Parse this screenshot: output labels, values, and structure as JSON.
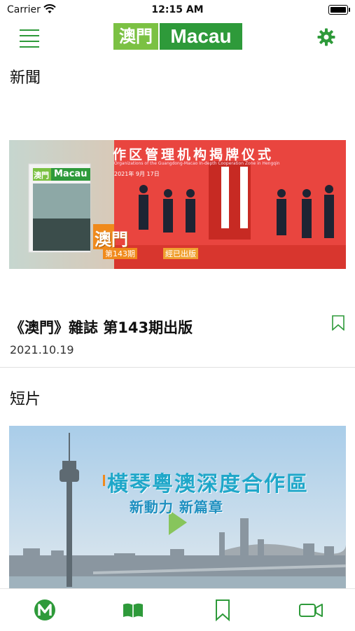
{
  "status": {
    "carrier": "Carrier",
    "time": "12:15 AM"
  },
  "header": {
    "logo_cn": "澳門",
    "logo_en": "Macau"
  },
  "news": {
    "section_label": "新聞",
    "article_title": "《澳門》雜誌 第143期出版",
    "article_date": "2021.10.19",
    "banner_heading": "作区管理机构揭牌仪式",
    "banner_sub": "Organizations of the Guangdong-Macao In-depth Cooperation Zone in Hengqin",
    "banner_date": "2021年 9月 17日",
    "magazine_logo_cn": "澳門",
    "magazine_logo_en": "Macau",
    "magazine_issue_label": "澳門",
    "magazine_issue_number": "第143期",
    "magazine_released": "經已出版"
  },
  "videos": {
    "section_label": "短片",
    "headline": "橫琴粵澳深度合作區",
    "subline": "新動力 新篇章"
  },
  "colors": {
    "accent": "#2e9a3a",
    "accent_light": "#7bc143",
    "banner_red": "#e6403b"
  },
  "tabbar": {
    "items": [
      {
        "icon": "macau-m-icon"
      },
      {
        "icon": "book-icon"
      },
      {
        "icon": "bookmark-icon"
      },
      {
        "icon": "video-camera-icon"
      }
    ]
  }
}
